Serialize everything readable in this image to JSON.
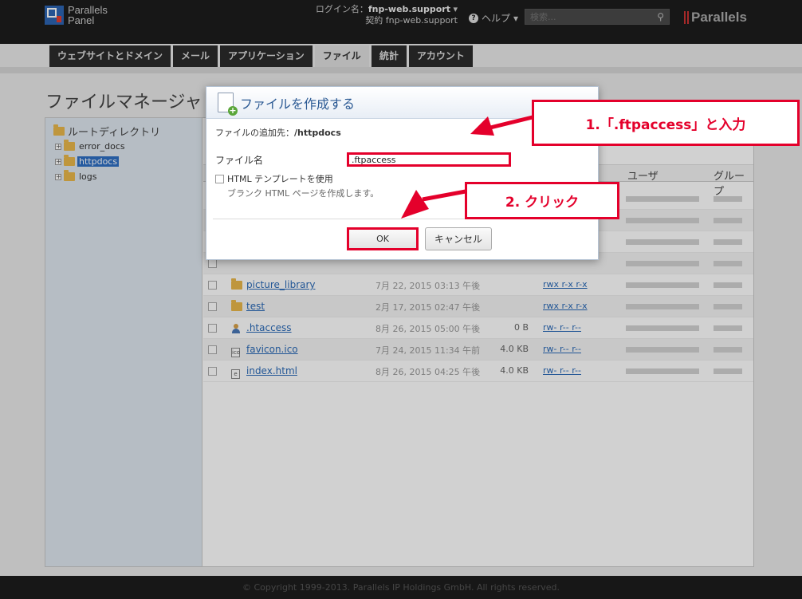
{
  "header": {
    "logo_line1": "Parallels",
    "logo_line2": "Panel",
    "login_label": "ログイン名：",
    "login_user": "fnp-web.support",
    "contract_label": "契約",
    "contract_user": "fnp-web.support",
    "help_label": "ヘルプ",
    "search_placeholder": "検索...",
    "brand": "Parallels"
  },
  "tabs": [
    {
      "label": "ウェブサイトとドメイン"
    },
    {
      "label": "メール"
    },
    {
      "label": "アプリケーション"
    },
    {
      "label": "ファイル",
      "active": true
    },
    {
      "label": "統計"
    },
    {
      "label": "アカウント"
    }
  ],
  "page_title": "ファイルマネージャ",
  "tree": {
    "root": "ルートディレクトリ",
    "items": [
      {
        "label": "error_docs"
      },
      {
        "label": "httpdocs",
        "selected": true
      },
      {
        "label": "logs"
      }
    ]
  },
  "columns": {
    "user": "ユーザ",
    "group": "グループ"
  },
  "files": [
    {
      "name": "picture_library",
      "modified": "7月 22, 2015 03:13 午後",
      "size": "",
      "perm": "rwx r-x r-x",
      "icon": "folder-icon"
    },
    {
      "name": "test",
      "modified": "2月 17, 2015 02:47 午後",
      "size": "",
      "perm": "rwx r-x r-x",
      "icon": "folder-icon"
    },
    {
      "name": ".htaccess",
      "modified": "8月 26, 2015 05:00 午後",
      "size": "0 B",
      "perm": "rw- r-- r--",
      "icon": "user-icon"
    },
    {
      "name": "favicon.ico",
      "modified": "7月 24, 2015 11:34 午前",
      "size": "4.0 KB",
      "perm": "rw- r-- r--",
      "icon": "image-file-icon"
    },
    {
      "name": "index.html",
      "modified": "8月 26, 2015 04:25 午後",
      "size": "4.0 KB",
      "perm": "rw- r-- r--",
      "icon": "html-file-icon"
    }
  ],
  "dialog": {
    "title": "ファイルを作成する",
    "dest_label": "ファイルの追加先：",
    "dest_path": "/httpdocs",
    "filename_label": "ファイル名",
    "filename_value": ".ftpaccess",
    "template_label": "HTML テンプレートを使用",
    "template_desc": "ブランク HTML ページを作成します。",
    "ok_label": "OK",
    "cancel_label": "キャンセル"
  },
  "annotations": {
    "step1": "1.「.ftpaccess」と入力",
    "step2": "2. クリック",
    "color": "#e4002b"
  },
  "footer": "© Copyright 1999-2013. Parallels IP Holdings GmbH. All rights reserved."
}
